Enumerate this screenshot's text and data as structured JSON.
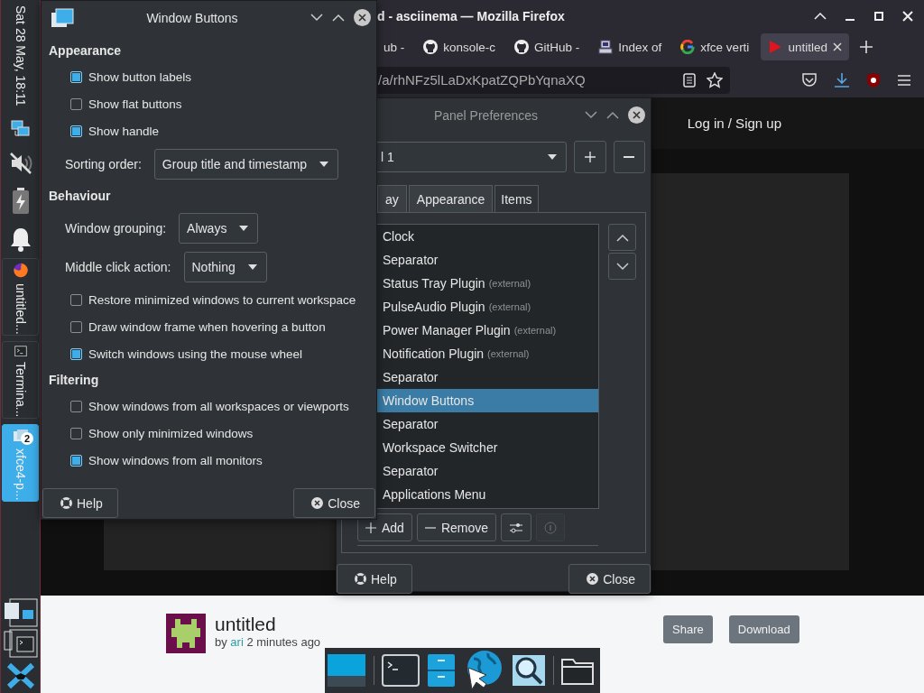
{
  "side_panel": {
    "clock": "Sat 28 May, 18:11",
    "tasks": [
      {
        "kind": "browser",
        "label": "untitled...",
        "selected": false
      },
      {
        "kind": "terminal",
        "label": "Termina...",
        "selected": false
      },
      {
        "kind": "settings",
        "label": "xfce4-p...",
        "selected": true,
        "badge": "2"
      }
    ]
  },
  "browser": {
    "title": "d - asciinema — Mozilla Firefox",
    "tabs": [
      {
        "kind": "plain",
        "label": "ub -",
        "selected": false
      },
      {
        "kind": "github",
        "label": "konsole-c",
        "selected": false
      },
      {
        "kind": "github",
        "label": "GitHub -",
        "selected": false
      },
      {
        "kind": "server",
        "label": "Index of",
        "selected": false
      },
      {
        "kind": "google",
        "label": "xfce verti",
        "selected": false
      },
      {
        "kind": "video",
        "label": "untitled",
        "selected": true
      }
    ],
    "url": "/a/rhNFz5lLaDxKpatZQPbYqnaXQ",
    "page": {
      "header_link": "Log in / Sign up",
      "recording_title": "untitled",
      "byline_before": "by",
      "author": "ari",
      "byline_after": "2 minutes ago",
      "share": "Share",
      "download": "Download"
    }
  },
  "window_buttons_dialog": {
    "title": "Window Buttons",
    "sections": [
      {
        "heading": "Appearance",
        "rows": [
          {
            "kind": "checkbox",
            "label": "Show button labels",
            "checked": true
          },
          {
            "kind": "checkbox",
            "label": "Show flat buttons",
            "checked": false
          },
          {
            "kind": "checkbox",
            "label": "Show handle",
            "checked": true
          },
          {
            "kind": "select",
            "label": "Sorting order:",
            "value": "Group title and timestamp"
          }
        ]
      },
      {
        "heading": "Behaviour",
        "rows": [
          {
            "kind": "select",
            "label": "Window grouping:",
            "value": "Always"
          },
          {
            "kind": "select",
            "label": "Middle click action:",
            "value": "Nothing"
          },
          {
            "kind": "checkbox",
            "label": "Restore minimized windows to current workspace",
            "checked": false
          },
          {
            "kind": "checkbox",
            "label": "Draw window frame when hovering a button",
            "checked": false
          },
          {
            "kind": "checkbox",
            "label": "Switch windows using the mouse wheel",
            "checked": true
          }
        ]
      },
      {
        "heading": "Filtering",
        "rows": [
          {
            "kind": "checkbox",
            "label": "Show windows from all workspaces or viewports",
            "checked": false
          },
          {
            "kind": "checkbox",
            "label": "Show only minimized windows",
            "checked": false
          },
          {
            "kind": "checkbox",
            "label": "Show windows from all monitors",
            "checked": true
          }
        ]
      }
    ],
    "help": "Help",
    "close": "Close"
  },
  "panel_preferences_dialog": {
    "title": "Panel Preferences",
    "panel_select": "l 1",
    "tabs": [
      {
        "label": "ay",
        "selected": false
      },
      {
        "label": "Appearance",
        "selected": false
      },
      {
        "label": "Items",
        "selected": true
      }
    ],
    "items": [
      {
        "name": "Clock",
        "selected": false
      },
      {
        "name": "Separator",
        "selected": false
      },
      {
        "name": "Status Tray Plugin",
        "note": "(external)",
        "selected": false
      },
      {
        "name": "PulseAudio Plugin",
        "note": "(external)",
        "selected": false
      },
      {
        "name": "Power Manager Plugin",
        "note": "(external)",
        "selected": false
      },
      {
        "name": "Notification Plugin",
        "note": "(external)",
        "selected": false
      },
      {
        "name": "Separator",
        "selected": false
      },
      {
        "name": "Window Buttons",
        "selected": true
      },
      {
        "name": "Separator",
        "selected": false
      },
      {
        "name": "Workspace Switcher",
        "selected": false
      },
      {
        "name": "Separator",
        "selected": false
      },
      {
        "name": "Applications Menu",
        "selected": false
      }
    ],
    "add": "Add",
    "remove": "Remove",
    "help": "Help",
    "close": "Close"
  }
}
